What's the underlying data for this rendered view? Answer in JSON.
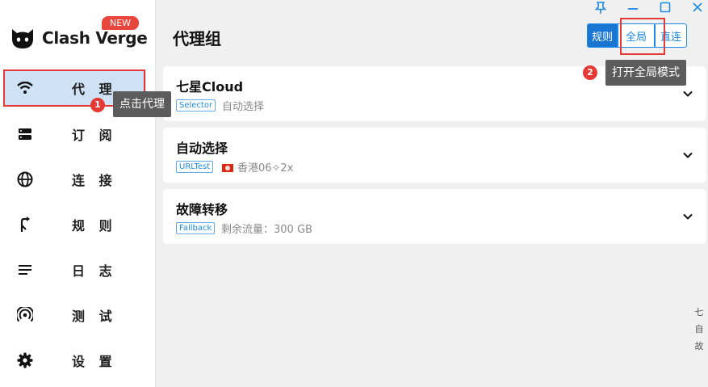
{
  "app": {
    "name": "Clash Verge",
    "badge": "NEW"
  },
  "sidebar": {
    "items": [
      {
        "label": "代 理",
        "icon": "wifi-icon",
        "active": true
      },
      {
        "label": "订 阅",
        "icon": "database-icon"
      },
      {
        "label": "连 接",
        "icon": "globe-icon"
      },
      {
        "label": "规 则",
        "icon": "route-icon"
      },
      {
        "label": "日 志",
        "icon": "list-icon"
      },
      {
        "label": "测 试",
        "icon": "radar-icon"
      },
      {
        "label": "设 置",
        "icon": "gear-icon"
      }
    ]
  },
  "header": {
    "title": "代理组",
    "modes": {
      "rule": "规则",
      "global": "全局",
      "direct": "直连"
    },
    "window_controls": [
      "pin-icon",
      "minimize-icon",
      "maximize-icon",
      "close-icon"
    ]
  },
  "groups": [
    {
      "name": "七星Cloud",
      "type": "Selector",
      "detail": "自动选择"
    },
    {
      "name": "自动选择",
      "type": "URLTest",
      "detail": "香港06✧2x",
      "flag": "hk"
    },
    {
      "name": "故障转移",
      "type": "Fallback",
      "detail": "剩余流量：300 GB"
    }
  ],
  "annotations": {
    "step1": {
      "num": "1",
      "text": "点击代理"
    },
    "step2": {
      "num": "2",
      "text": "打开全局模式"
    }
  },
  "side_index": [
    "七",
    "自",
    "故"
  ],
  "colors": {
    "accent": "#1976d2",
    "annotation_red": "#e53935",
    "active_nav": "#cfe1f5"
  }
}
